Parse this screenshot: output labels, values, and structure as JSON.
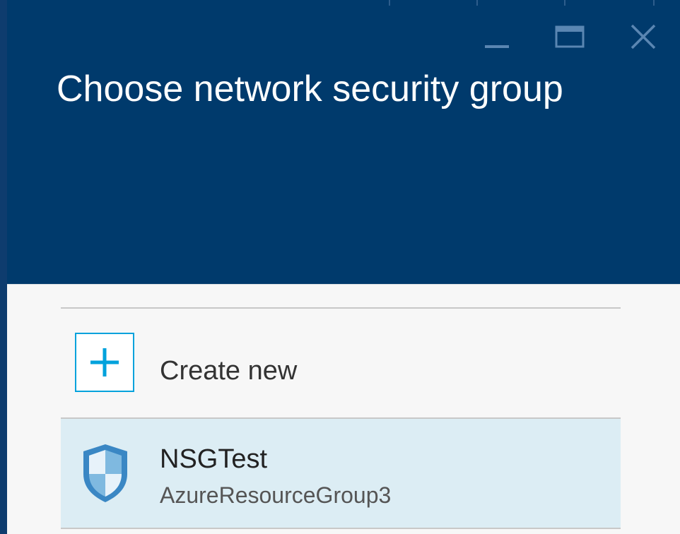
{
  "blade": {
    "title": "Choose network security group",
    "window_controls": {
      "minimize_icon": "minimize-icon",
      "maximize_icon": "maximize-icon",
      "close_icon": "close-icon"
    },
    "colors": {
      "header_bg": "#003a6c",
      "accent": "#00a2dc",
      "selected_row_bg": "#dcedf4",
      "content_bg": "#f7f7f7"
    }
  },
  "list": {
    "create_new": {
      "label": "Create new",
      "icon": "plus-icon"
    },
    "items": [
      {
        "name": "NSGTest",
        "resource_group": "AzureResourceGroup3",
        "icon": "shield-icon",
        "selected": true
      }
    ]
  }
}
